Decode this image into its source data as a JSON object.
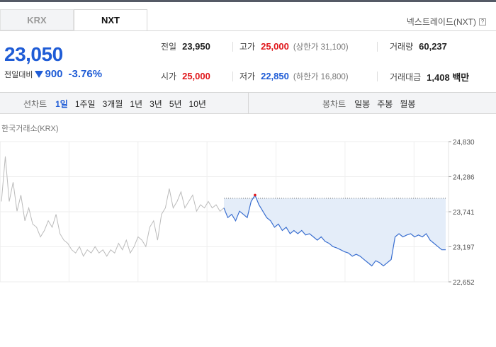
{
  "tabs": [
    {
      "label": "KRX",
      "active": false
    },
    {
      "label": "NXT",
      "active": true
    }
  ],
  "source_label": "넥스트레이드(NXT)",
  "help_icon": "?",
  "price": "23,050",
  "change": {
    "label": "전일대비",
    "amount": "900",
    "pct": "-3.76%",
    "direction": "down"
  },
  "stats": {
    "prev": {
      "k": "전일",
      "v": "23,950"
    },
    "high": {
      "k": "고가",
      "v": "25,000",
      "sub": "(상한가 31,100)"
    },
    "volume": {
      "k": "거래량",
      "v": "60,237"
    },
    "open": {
      "k": "시가",
      "v": "25,000"
    },
    "low": {
      "k": "저가",
      "v": "22,850",
      "sub": "(하한가 16,800)"
    },
    "amount": {
      "k": "거래대금",
      "v": "1,408 백만"
    }
  },
  "toolbar": {
    "line_title": "선차트",
    "line_options": [
      "1일",
      "1주일",
      "3개월",
      "1년",
      "3년",
      "5년",
      "10년"
    ],
    "line_active": "1일",
    "candle_title": "봉차트",
    "candle_options": [
      "일봉",
      "주봉",
      "월봉"
    ]
  },
  "chart_label": "한국거래소(KRX)",
  "chart_data": {
    "type": "line",
    "ylim": [
      22652,
      24830
    ],
    "yticks": [
      "24,830",
      "24,286",
      "23,741",
      "23,197",
      "22,652"
    ],
    "tick_values": [
      24830,
      24286,
      23741,
      23197,
      22652
    ],
    "reference": 23950,
    "series": [
      {
        "values": [
          23900,
          24600,
          23900,
          24200,
          23750,
          24000,
          23600,
          23800,
          23550,
          23500,
          23350,
          23450,
          23600,
          23500,
          23700,
          23400,
          23300,
          23250,
          23150,
          23100,
          23200,
          23050,
          23150,
          23100,
          23200,
          23100,
          23150,
          23050,
          23150,
          23100,
          23250,
          23150,
          23300,
          23100,
          23200,
          23350,
          23300,
          23200,
          23500,
          23600,
          23300,
          23700,
          23800,
          24100,
          23800,
          23900,
          24050,
          23800,
          23900,
          24000,
          23750,
          23850,
          23800,
          23900,
          23800,
          23850,
          23750,
          23800
        ],
        "color": "#bbbbbb"
      },
      {
        "values": [
          23800,
          23650,
          23700,
          23600,
          23750,
          23700,
          23650,
          23900,
          24000,
          23850,
          23750,
          23650,
          23600,
          23500,
          23550,
          23450,
          23500,
          23400,
          23450,
          23400,
          23450,
          23380,
          23400,
          23350,
          23300,
          23350,
          23280,
          23250,
          23200,
          23180,
          23150,
          23120,
          23100,
          23050,
          23080,
          23050,
          23000,
          22950,
          22900,
          22980,
          22950,
          22900,
          22950,
          23000,
          23350,
          23400,
          23350,
          23380,
          23400,
          23350,
          23380,
          23350,
          23400,
          23300,
          23250,
          23200,
          23150,
          23150
        ],
        "color": "#3a6fd0"
      }
    ]
  }
}
